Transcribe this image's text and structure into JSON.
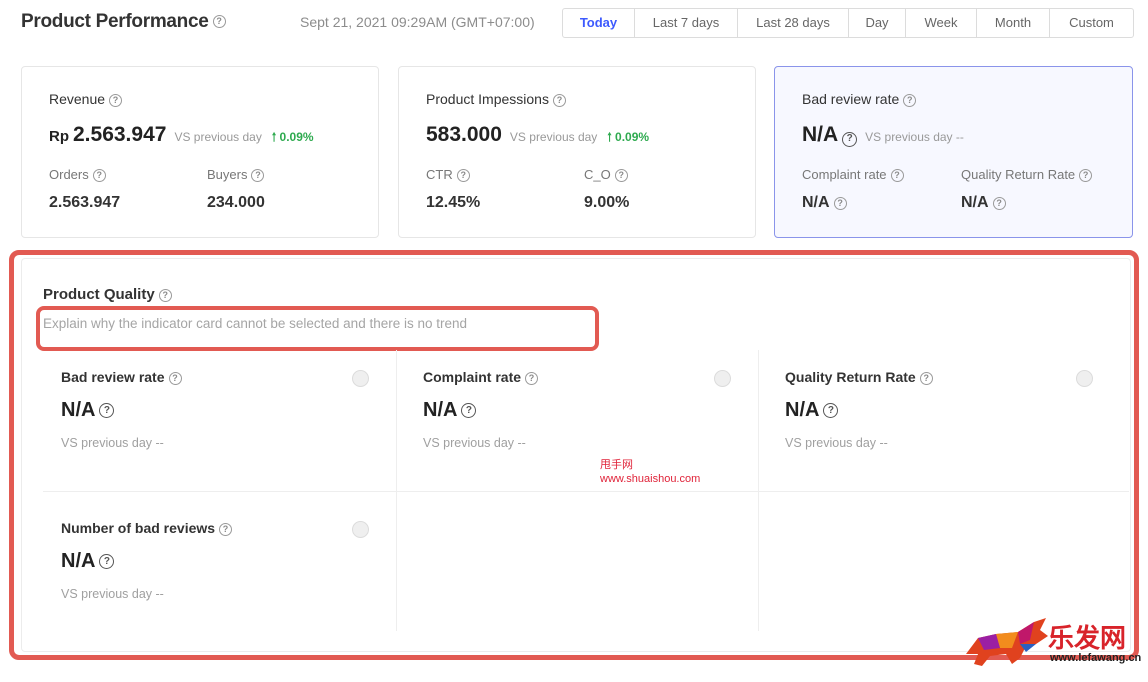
{
  "header": {
    "title": "Product Performance",
    "datetime": "Sept 21, 2021 09:29AM (GMT+07:00)",
    "ranges": [
      "Today",
      "Last 7 days",
      "Last 28 days",
      "Day",
      "Week",
      "Month",
      "Custom"
    ],
    "active_range": "Today"
  },
  "icons": {
    "help": "?",
    "arrow_up": "🠑"
  },
  "summary": {
    "revenue": {
      "title": "Revenue",
      "currency": "Rp",
      "value": "2.563.947",
      "vs": "VS previous day",
      "delta": "0.09%",
      "sub1_label": "Orders",
      "sub1_value": "2.563.947",
      "sub2_label": "Buyers",
      "sub2_value": "234.000"
    },
    "impressions": {
      "title": "Product Impessions",
      "value": "583.000",
      "vs": "VS previous day",
      "delta": "0.09%",
      "sub1_label": "CTR",
      "sub1_value": "12.45%",
      "sub2_label": "C_O",
      "sub2_value": "9.00%"
    },
    "bad_review": {
      "title": "Bad review rate",
      "value": "N/A",
      "vs": "VS previous day --",
      "sub1_label": "Complaint rate",
      "sub1_value": "N/A",
      "sub2_label": "Quality Return Rate",
      "sub2_value": "N/A"
    }
  },
  "quality": {
    "title": "Product Quality",
    "description": "Explain why the indicator card cannot be selected and there is no trend",
    "cards": [
      {
        "title": "Bad review rate",
        "value": "N/A",
        "vs": "VS previous day --"
      },
      {
        "title": "Complaint rate",
        "value": "N/A",
        "vs": "VS previous day --"
      },
      {
        "title": "Quality Return Rate",
        "value": "N/A",
        "vs": "VS previous day --"
      },
      {
        "title": "Number of bad reviews",
        "value": "N/A",
        "vs": "VS previous day --"
      }
    ]
  },
  "watermark": {
    "cn": "甩手网",
    "url": "www.shuaishou.com",
    "logo_text": "乐发网",
    "logo_url": "www.lefawang.cn"
  },
  "colors": {
    "accent": "#3d5afe",
    "positive": "#2eaa4f",
    "highlight": "#e25a52",
    "selected_border": "#8a94ea"
  }
}
